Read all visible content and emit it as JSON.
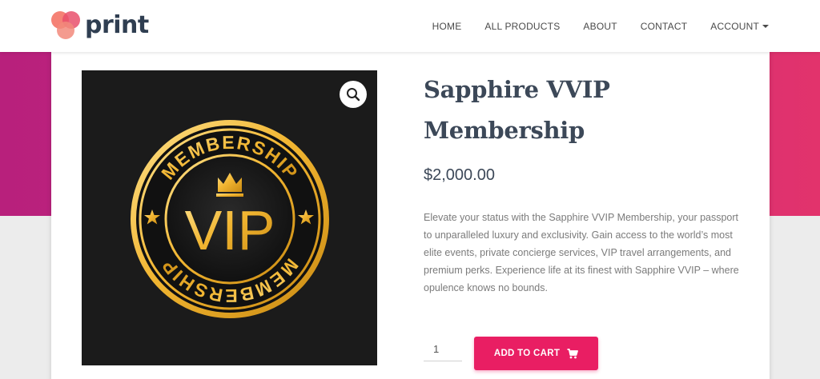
{
  "header": {
    "logo_text": "print",
    "nav": [
      {
        "label": "HOME"
      },
      {
        "label": "ALL PRODUCTS"
      },
      {
        "label": "ABOUT"
      },
      {
        "label": "CONTACT"
      },
      {
        "label": "ACCOUNT"
      }
    ]
  },
  "product": {
    "title_line1": "Sapphire VVIP",
    "title_line2": "Membership",
    "price": "$2,000.00",
    "description": "Elevate your status with the Sapphire VVIP Membership, your passport to unparalleled luxury and exclusivity. Gain access to the world’s most elite events, private concierge services, VIP travel arrangements, and premium perks. Experience life at its finest with Sapphire VVIP – where opulence knows no bounds.",
    "image": {
      "badge_top_text": "MEMBERSHIP",
      "badge_center_text": "VIP",
      "badge_bottom_text": "MEMBERSHIP"
    },
    "quantity": "1",
    "add_to_cart_label": "ADD TO CART"
  },
  "icons": {
    "zoom": "search-icon",
    "cart": "cart-icon",
    "account_caret": "caret-down-icon"
  },
  "colors": {
    "accent": "#e91e63",
    "band_start": "#b8207c",
    "band_end": "#e2336c",
    "heading": "#3c4858",
    "gold": "#f2b632"
  }
}
